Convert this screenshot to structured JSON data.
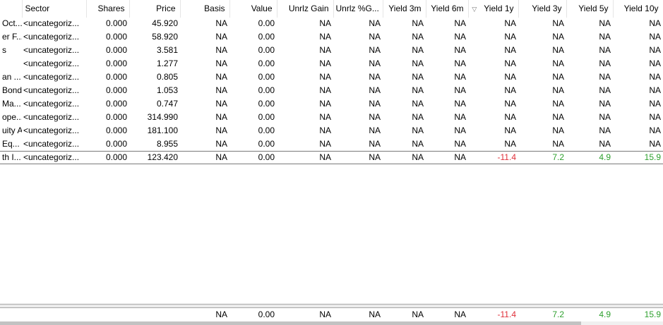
{
  "columns": [
    {
      "key": "name",
      "label": ""
    },
    {
      "key": "sector",
      "label": "Sector"
    },
    {
      "key": "shares",
      "label": "Shares"
    },
    {
      "key": "price",
      "label": "Price"
    },
    {
      "key": "basis",
      "label": "Basis"
    },
    {
      "key": "value",
      "label": "Value"
    },
    {
      "key": "unrlz_gain",
      "label": "Unrlz Gain"
    },
    {
      "key": "unrlz_pct",
      "label": "Unrlz %G..."
    },
    {
      "key": "yield_3m",
      "label": "Yield 3m"
    },
    {
      "key": "yield_6m",
      "label": "Yield 6m"
    },
    {
      "key": "yield_1y",
      "label": "Yield 1y"
    },
    {
      "key": "yield_3y",
      "label": "Yield 3y"
    },
    {
      "key": "yield_5y",
      "label": "Yield 5y"
    },
    {
      "key": "yield_10y",
      "label": "Yield 10y"
    }
  ],
  "sort": {
    "column": "yield_1y",
    "direction_icon": "▽"
  },
  "rows": [
    {
      "name": "Oct...",
      "sector": "<uncategoriz...",
      "shares": "0.000",
      "price": "45.920",
      "basis": "NA",
      "value": "0.00",
      "unrlz_gain": "NA",
      "unrlz_pct": "NA",
      "yield_3m": "NA",
      "yield_6m": "NA",
      "yield_1y": "NA",
      "yield_3y": "NA",
      "yield_5y": "NA",
      "yield_10y": "NA"
    },
    {
      "name": "er F...",
      "sector": "<uncategoriz...",
      "shares": "0.000",
      "price": "58.920",
      "basis": "NA",
      "value": "0.00",
      "unrlz_gain": "NA",
      "unrlz_pct": "NA",
      "yield_3m": "NA",
      "yield_6m": "NA",
      "yield_1y": "NA",
      "yield_3y": "NA",
      "yield_5y": "NA",
      "yield_10y": "NA"
    },
    {
      "name": "s",
      "sector": "<uncategoriz...",
      "shares": "0.000",
      "price": "3.581",
      "basis": "NA",
      "value": "0.00",
      "unrlz_gain": "NA",
      "unrlz_pct": "NA",
      "yield_3m": "NA",
      "yield_6m": "NA",
      "yield_1y": "NA",
      "yield_3y": "NA",
      "yield_5y": "NA",
      "yield_10y": "NA"
    },
    {
      "name": "",
      "sector": "<uncategoriz...",
      "shares": "0.000",
      "price": "1.277",
      "basis": "NA",
      "value": "0.00",
      "unrlz_gain": "NA",
      "unrlz_pct": "NA",
      "yield_3m": "NA",
      "yield_6m": "NA",
      "yield_1y": "NA",
      "yield_3y": "NA",
      "yield_5y": "NA",
      "yield_10y": "NA"
    },
    {
      "name": "an ...",
      "sector": "<uncategoriz...",
      "shares": "0.000",
      "price": "0.805",
      "basis": "NA",
      "value": "0.00",
      "unrlz_gain": "NA",
      "unrlz_pct": "NA",
      "yield_3m": "NA",
      "yield_6m": "NA",
      "yield_1y": "NA",
      "yield_3y": "NA",
      "yield_5y": "NA",
      "yield_10y": "NA"
    },
    {
      "name": "Bond",
      "sector": "<uncategoriz...",
      "shares": "0.000",
      "price": "1.053",
      "basis": "NA",
      "value": "0.00",
      "unrlz_gain": "NA",
      "unrlz_pct": "NA",
      "yield_3m": "NA",
      "yield_6m": "NA",
      "yield_1y": "NA",
      "yield_3y": "NA",
      "yield_5y": "NA",
      "yield_10y": "NA"
    },
    {
      "name": "Ma...",
      "sector": "<uncategoriz...",
      "shares": "0.000",
      "price": "0.747",
      "basis": "NA",
      "value": "0.00",
      "unrlz_gain": "NA",
      "unrlz_pct": "NA",
      "yield_3m": "NA",
      "yield_6m": "NA",
      "yield_1y": "NA",
      "yield_3y": "NA",
      "yield_5y": "NA",
      "yield_10y": "NA"
    },
    {
      "name": "ope...",
      "sector": "<uncategoriz...",
      "shares": "0.000",
      "price": "314.990",
      "basis": "NA",
      "value": "0.00",
      "unrlz_gain": "NA",
      "unrlz_pct": "NA",
      "yield_3m": "NA",
      "yield_6m": "NA",
      "yield_1y": "NA",
      "yield_3y": "NA",
      "yield_5y": "NA",
      "yield_10y": "NA"
    },
    {
      "name": "uity A",
      "sector": "<uncategoriz...",
      "shares": "0.000",
      "price": "181.100",
      "basis": "NA",
      "value": "0.00",
      "unrlz_gain": "NA",
      "unrlz_pct": "NA",
      "yield_3m": "NA",
      "yield_6m": "NA",
      "yield_1y": "NA",
      "yield_3y": "NA",
      "yield_5y": "NA",
      "yield_10y": "NA"
    },
    {
      "name": "Eq...",
      "sector": "<uncategoriz...",
      "shares": "0.000",
      "price": "8.955",
      "basis": "NA",
      "value": "0.00",
      "unrlz_gain": "NA",
      "unrlz_pct": "NA",
      "yield_3m": "NA",
      "yield_6m": "NA",
      "yield_1y": "NA",
      "yield_3y": "NA",
      "yield_5y": "NA",
      "yield_10y": "NA"
    },
    {
      "name": "th I...",
      "sector": "<uncategoriz...",
      "shares": "0.000",
      "price": "123.420",
      "basis": "NA",
      "value": "0.00",
      "unrlz_gain": "NA",
      "unrlz_pct": "NA",
      "yield_3m": "NA",
      "yield_6m": "NA",
      "yield_1y": "-11.4",
      "yield_3y": "7.2",
      "yield_5y": "4.9",
      "yield_10y": "15.9",
      "selected": true
    }
  ],
  "totals": {
    "name": "",
    "sector": "",
    "shares": "",
    "price": "",
    "basis": "NA",
    "value": "0.00",
    "unrlz_gain": "NA",
    "unrlz_pct": "NA",
    "yield_3m": "NA",
    "yield_6m": "NA",
    "yield_1y": "-11.4",
    "yield_3y": "7.2",
    "yield_5y": "4.9",
    "yield_10y": "15.9"
  },
  "colors": {
    "negative": "#e0303a",
    "positive": "#2ea02e"
  }
}
